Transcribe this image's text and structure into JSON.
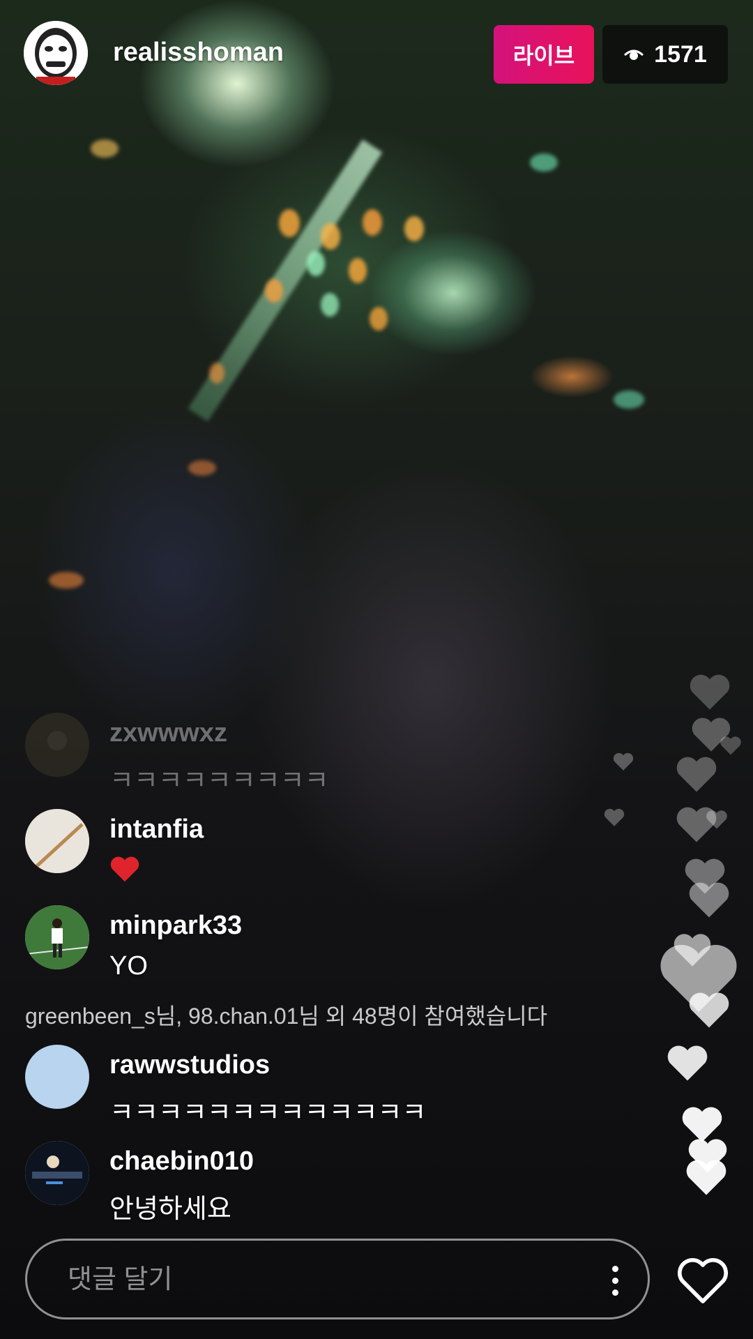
{
  "header": {
    "host_username": "realisshoman",
    "live_label": "라이브",
    "viewer_count": "1571"
  },
  "comments": [
    {
      "username": "zxwwwxz",
      "text": "ㅋㅋㅋㅋㅋㅋㅋㅋㅋ",
      "faded": true,
      "avatar": "dark-texture-avatar"
    },
    {
      "username": "intanfia",
      "text": "❤️",
      "faded": false,
      "avatar": "stick-avatar"
    },
    {
      "username": "minpark33",
      "text": "YO",
      "faded": false,
      "avatar": "baseball-player-avatar"
    }
  ],
  "joined_notice": "greenbeen_s님, 98.chan.01님 외 48명이 참여했습니다",
  "comments_after": [
    {
      "username": "rawwstudios",
      "text": "ㅋㅋㅋㅋㅋㅋㅋㅋㅋㅋㅋㅋㅋ",
      "avatar": "light-blue-avatar"
    },
    {
      "username": "chaebin010",
      "text": "안녕하세요",
      "avatar": "night-scene-avatar"
    }
  ],
  "comment_input": {
    "placeholder": "댓글 달기"
  },
  "icons": {
    "viewer_icon": "eye-icon",
    "more_icon": "more-vertical-icon",
    "like_icon": "heart-outline-icon",
    "floating_icon": "heart-icon"
  },
  "colors": {
    "live_badge": "#e0126a",
    "viewer_badge_bg": "#0c0c0c",
    "reaction_heart": "#e0242c"
  }
}
